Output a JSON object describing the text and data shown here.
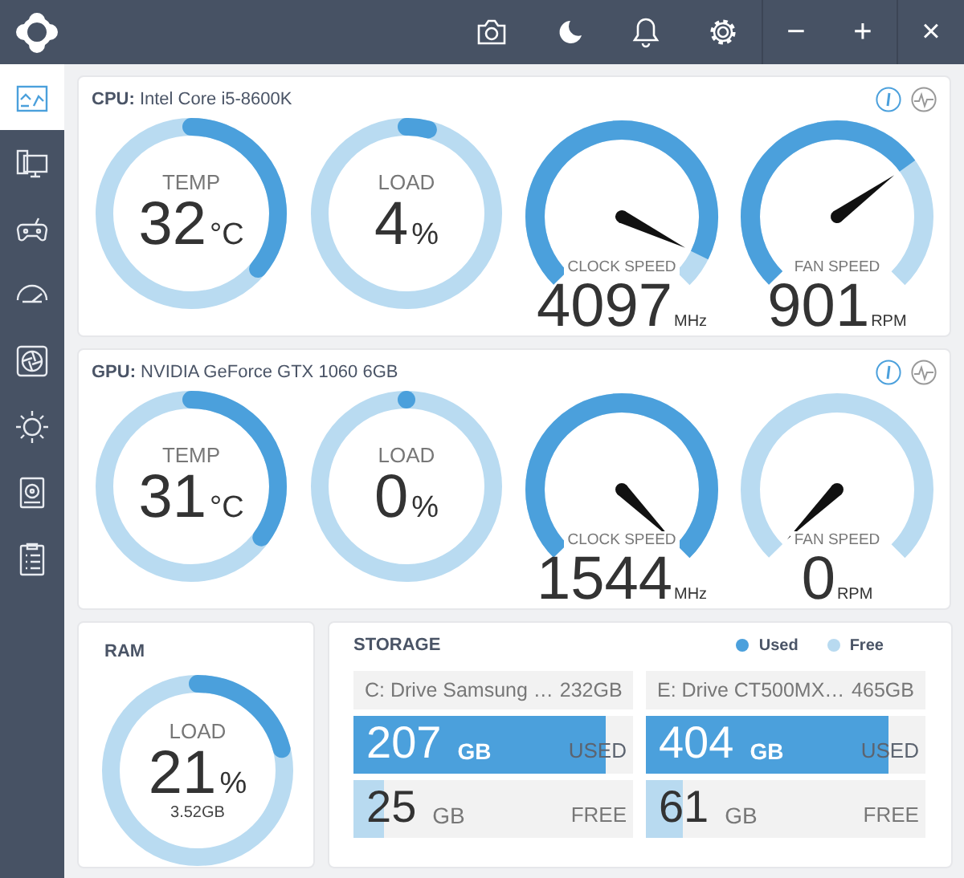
{
  "topbar": {
    "window_buttons": [
      "−",
      "+",
      "×"
    ]
  },
  "sidebar": {
    "items": [
      {
        "selected": true
      },
      {
        "selected": false
      },
      {
        "selected": false
      },
      {
        "selected": false
      },
      {
        "selected": false
      },
      {
        "selected": false
      },
      {
        "selected": false
      },
      {
        "selected": false
      }
    ]
  },
  "panels": [
    {
      "title": "**CPU:** Intel Core i5-8600K",
      "view_buttons": [
        {
          "selected": true
        },
        {
          "selected": false
        }
      ],
      "gauges": [
        {
          "kind": "ring",
          "label": "TEMP",
          "value": "32",
          "unit": "°C",
          "level": 0.36
        },
        {
          "kind": "ring",
          "label": "LOAD",
          "value": "4",
          "unit": "%",
          "level": 0.04
        },
        {
          "kind": "dial",
          "label": "CLOCK SPEED",
          "value": "4097",
          "unit": "MHz",
          "level": 0.93
        },
        {
          "kind": "dial",
          "label": "FAN SPEED",
          "value": "901",
          "unit": "RPM",
          "level": 0.7
        }
      ]
    },
    {
      "title": "**GPU:** NVIDIA GeForce GTX 1060 6GB",
      "view_buttons": [
        {
          "selected": true
        },
        {
          "selected": false
        }
      ],
      "gauges": [
        {
          "kind": "ring",
          "label": "TEMP",
          "value": "31",
          "unit": "°C",
          "level": 0.35
        },
        {
          "kind": "ring",
          "label": "LOAD",
          "value": "0",
          "unit": "%",
          "level": 0.0
        },
        {
          "kind": "dial",
          "label": "CLOCK SPEED",
          "value": "1544",
          "unit": "MHz",
          "level": 1.0
        },
        {
          "kind": "dial",
          "label": "FAN SPEED",
          "value": "0",
          "unit": "RPM",
          "level": 0.0
        }
      ]
    }
  ],
  "ram": {
    "title": "RAM",
    "gauge": {
      "label": "LOAD",
      "value": "21",
      "unit": "%",
      "sub": "3.52GB",
      "level": 0.21
    }
  },
  "storage": {
    "title": "STORAGE",
    "legend": [
      {
        "label": "Used",
        "color": "#4ba0dc"
      },
      {
        "label": "Free",
        "color": "#b8daf0"
      }
    ],
    "drives": [
      {
        "name": "C: Drive Samsung …",
        "size": "232GB",
        "used": {
          "value": "207",
          "unit": "GB",
          "label": "USED",
          "level": 0.9
        },
        "free": {
          "value": "25",
          "unit": "GB",
          "label": "FREE",
          "level": 0.11
        }
      },
      {
        "name": "E: Drive CT500MX…",
        "size": "465GB",
        "used": {
          "value": "404",
          "unit": "GB",
          "label": "USED",
          "level": 0.87
        },
        "free": {
          "value": "61",
          "unit": "GB",
          "label": "FREE",
          "level": 0.13
        }
      }
    ]
  }
}
